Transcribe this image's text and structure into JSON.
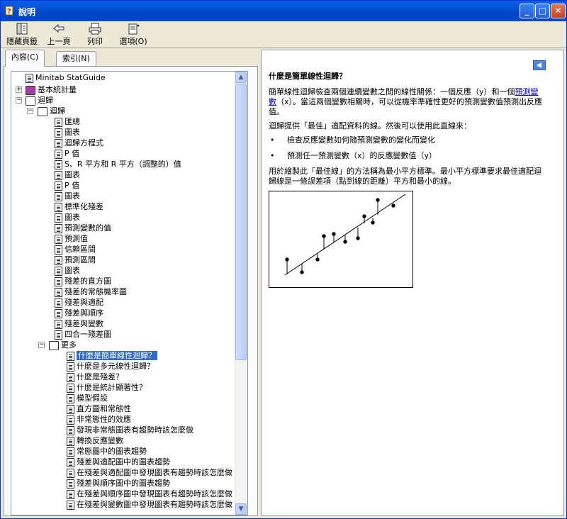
{
  "window": {
    "title": "說明"
  },
  "toolbar": {
    "hide_label": "隱藏頁籤",
    "back_label": "上一頁",
    "print_label": "列印",
    "options_label": "選項(O)"
  },
  "tabs": {
    "contents": "內容(C)",
    "index": "索引(N)"
  },
  "tree": {
    "n0": "Minitab StatGuide",
    "n1": "基本統計量",
    "n2": "迴歸",
    "n3": "迴歸",
    "items": [
      "匯總",
      "圖表",
      "迴歸方程式",
      "P 值",
      "S、R 平方和 R 平方（調整的）值",
      "圖表",
      "P 值",
      "圖表",
      "標準化殘差",
      "圖表",
      "預測變數的值",
      "預測值",
      "信賴區間",
      "預測區間",
      "圖表",
      "殘差的直方圖",
      "殘差的常態機率圖",
      "殘差與適配",
      "殘差與順序",
      "殘差與變數",
      "四合一殘差圖"
    ],
    "more": "更多",
    "sub": [
      "什麼是簡單線性迴歸？",
      "什麼是多元線性迴歸？",
      "什麼是殘差？",
      "什麼是統計顯著性？",
      "模型假設",
      "直方圖和常態性",
      "非常態性的效應",
      "發現非常態圖表有趨勢時該怎麼做",
      "轉換反應變數",
      "常態圖中的圖表趨勢",
      "殘差與適配圖中的圖表趨勢",
      "在殘差與適配圖中發現圖表有趨勢時該怎麼做",
      "殘差與順序圖中的圖表趨勢",
      "在殘差與順序圖中發現圖表有趨勢時該怎麼做",
      "在殘差與變數圖中發現圖表有趨勢時該怎麼做"
    ]
  },
  "content": {
    "heading": "什麼是簡單線性迴歸？",
    "p1_a": "簡單線性迴歸檢查兩個連續變數之間的線性關係：一個反應（y）和一個",
    "p1_link": "預測變數",
    "p1_b": "（x）。當這兩個變數相關時，可以從機率準確性更好的預測變數值預測出反應值。",
    "p2": "迴歸提供「最佳」適配資料的線。然後可以使用此直線來：",
    "b1": "檢查反應變數如何隨預測變數的變化而變化",
    "b2": "預測任一預測變數（x）的反應變數值（y）",
    "p3": "用於繪製此「最佳線」的方法稱為最小平方標準。最小平方標準要求最佳適配迴歸線是一條誤差項（點到線的距離）平方和最小的線。"
  },
  "colors": {
    "titlebar": "#0451d4",
    "selection": "#316ac5",
    "link": "#0000cc"
  }
}
